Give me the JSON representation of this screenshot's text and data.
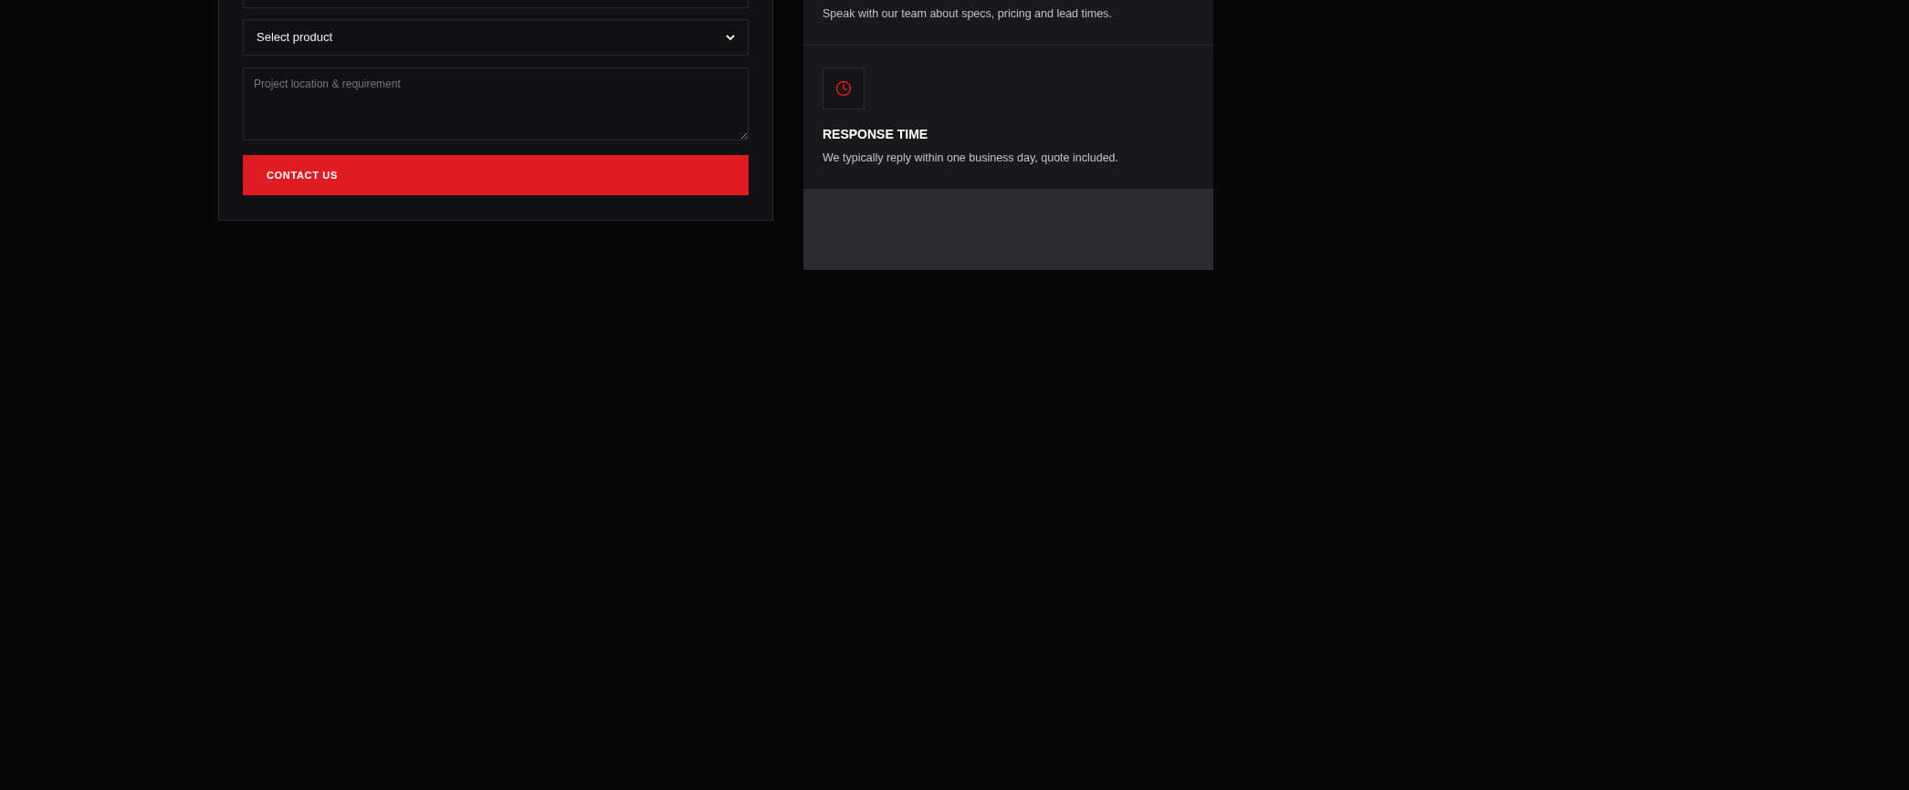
{
  "form": {
    "select": {
      "value": "Select product"
    },
    "textarea": {
      "placeholder": "Project location & requirement"
    },
    "submit": "CONTACT US"
  },
  "info_cards": [
    {
      "description": "Speak with our team about specs, pricing and lead times."
    },
    {
      "kind": "clock",
      "title": "RESPONSE TIME",
      "description": "We typically reply within one business day, quote included."
    }
  ]
}
